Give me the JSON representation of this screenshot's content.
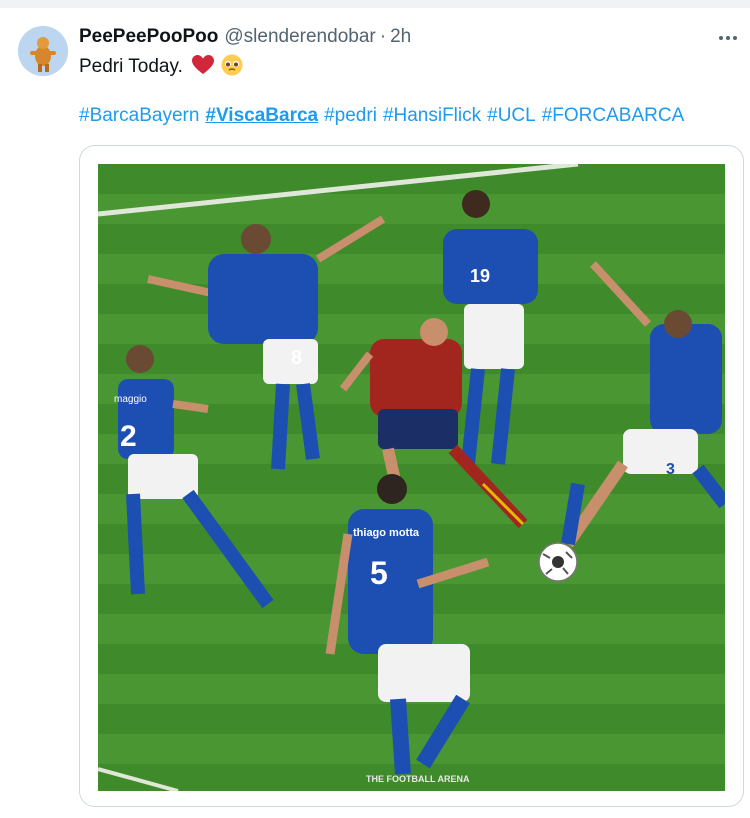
{
  "tweet": {
    "display_name": "PeePeePooPoo",
    "handle": "@slenderendobar",
    "separator": "·",
    "time": "2h",
    "more_icon": "more-horizontal-icon",
    "text": "Pedri Today.",
    "emojis": [
      "red-heart",
      "pleading-face"
    ],
    "hashtags": [
      "#BarcaBayern",
      "#ViscaBarca",
      "#pedri",
      "#HansiFlick",
      "#UCL",
      "#FORCABARCA"
    ],
    "media": {
      "watermark": "THE FOOTBALL ARENA",
      "players": [
        {
          "name": "maggio",
          "number": "2"
        },
        {
          "name": "",
          "number": "8"
        },
        {
          "name": "",
          "number": "19"
        },
        {
          "name": "thiago motta",
          "number": "5"
        },
        {
          "name": "",
          "number": "3"
        }
      ]
    }
  },
  "colors": {
    "link": "#1d9bf0",
    "secondary_text": "#536471",
    "pitch": "#3f8a2a",
    "italy_blue": "#1d4fb3",
    "spain_red": "#a3261e"
  }
}
